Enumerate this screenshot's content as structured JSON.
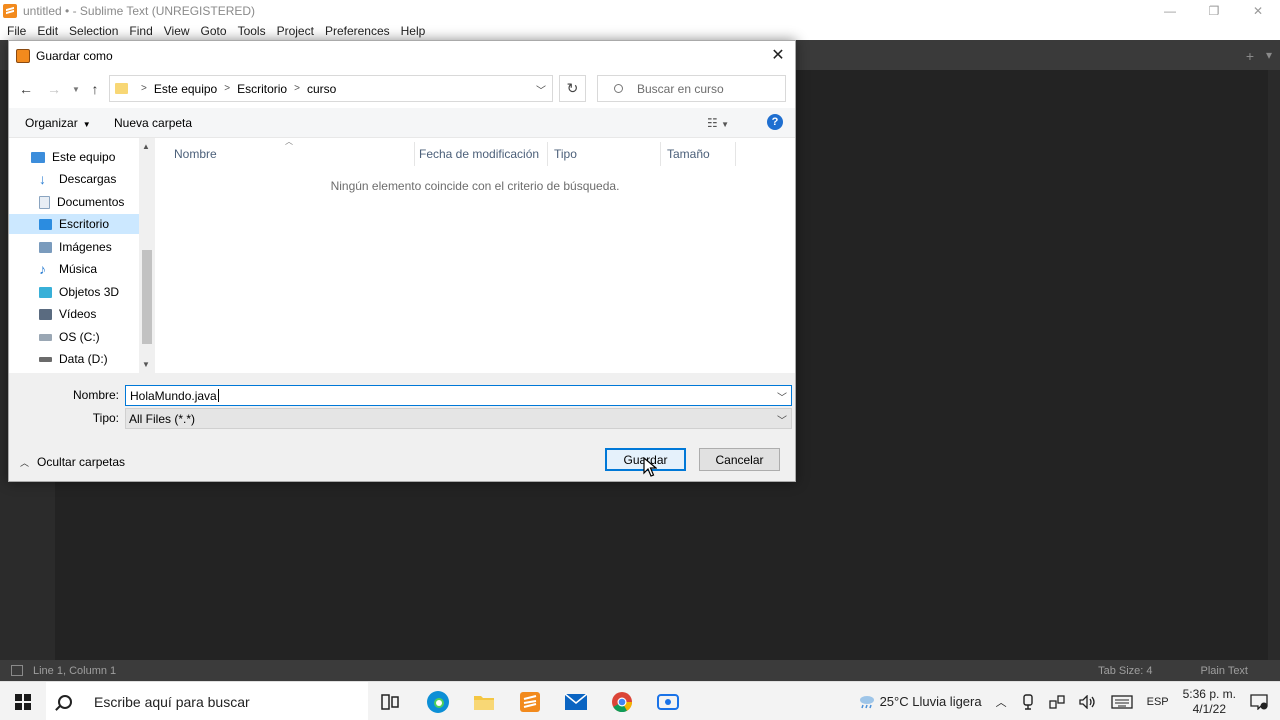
{
  "window": {
    "title": "untitled • - Sublime Text (UNREGISTERED)",
    "controls": [
      "—",
      "❐",
      "✕"
    ]
  },
  "menubar": [
    "File",
    "Edit",
    "Selection",
    "Find",
    "View",
    "Goto",
    "Tools",
    "Project",
    "Preferences",
    "Help"
  ],
  "statusbar": {
    "position": "Line 1, Column 1",
    "tab_size": "Tab Size: 4",
    "syntax": "Plain Text"
  },
  "dialog": {
    "title": "Guardar como",
    "breadcrumb": [
      "Este equipo",
      "Escritorio",
      "curso"
    ],
    "search_placeholder": "Buscar en curso",
    "toolbar": {
      "organize": "Organizar",
      "new_folder": "Nueva carpeta",
      "help": "?"
    },
    "nav_items": [
      {
        "label": "Este equipo",
        "icon": "pc-icon"
      },
      {
        "label": "Descargas",
        "icon": "download-icon"
      },
      {
        "label": "Documentos",
        "icon": "document-icon"
      },
      {
        "label": "Escritorio",
        "icon": "desktop-icon"
      },
      {
        "label": "Imágenes",
        "icon": "pictures-icon"
      },
      {
        "label": "Música",
        "icon": "music-icon"
      },
      {
        "label": "Objetos 3D",
        "icon": "objects3d-icon"
      },
      {
        "label": "Vídeos",
        "icon": "videos-icon"
      },
      {
        "label": "OS (C:)",
        "icon": "drive-icon"
      },
      {
        "label": "Data (D:)",
        "icon": "drive-icon"
      }
    ],
    "columns": [
      "Nombre",
      "Fecha de modificación",
      "Tipo",
      "Tamaño"
    ],
    "empty_message": "Ningún elemento coincide con el criterio de búsqueda.",
    "name_label": "Nombre:",
    "name_value": "HolaMundo.java",
    "type_label": "Tipo:",
    "type_value": "All Files (*.*)",
    "hide_folders": "Ocultar carpetas",
    "save_button": "Guardar",
    "cancel_button": "Cancelar"
  },
  "taskbar": {
    "search_placeholder": "Escribe aquí para buscar",
    "weather": "25°C  Lluvia ligera",
    "language": "ESP",
    "time": "5:36 p. m.",
    "date": "4/1/22"
  },
  "colors": {
    "accent": "#0078d7",
    "sublime_orange": "#f28a1d",
    "editor_bg": "#232323",
    "selection": "#cce8ff"
  }
}
